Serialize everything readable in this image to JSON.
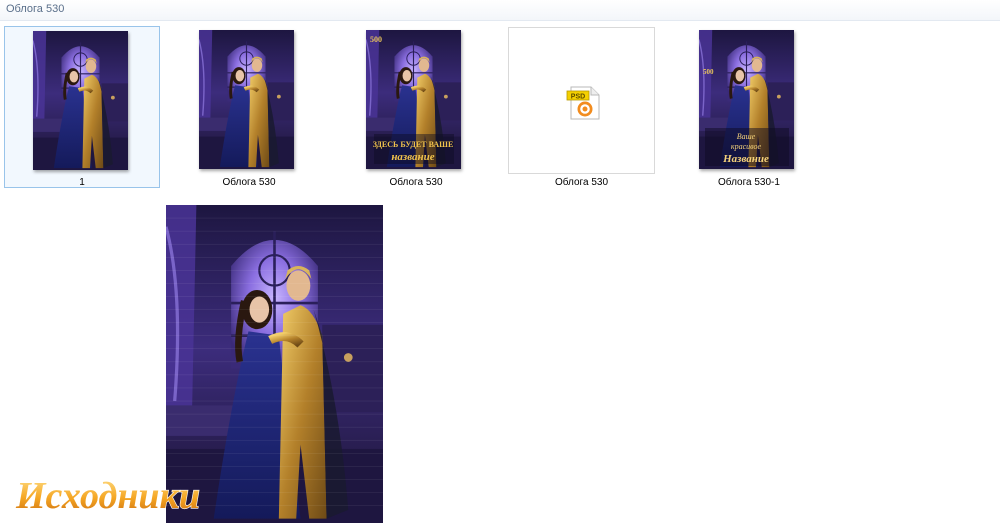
{
  "window": {
    "title": "Облога 530"
  },
  "files": [
    {
      "name": "1",
      "type": "image",
      "selected": true
    },
    {
      "name": "Облога  530",
      "type": "image",
      "selected": false
    },
    {
      "name": "Облога 530",
      "type": "image-with-title",
      "selected": false,
      "overlay_text": [
        "ЗДЕСЬ БУДЕТ ВАШЕ",
        "название"
      ],
      "badge": "500"
    },
    {
      "name": "Облога 530",
      "type": "psd",
      "selected": false,
      "badge": "PSD"
    },
    {
      "name": "Облога 530-1",
      "type": "image-with-title",
      "selected": false,
      "overlay_text": [
        "Ваше",
        "красивое",
        "Название"
      ],
      "badge": "500"
    }
  ],
  "watermark": {
    "text": "Исходники"
  },
  "colors": {
    "selection_border": "#99c4ea",
    "selection_fill": "#f2f8fe",
    "title_text": "#5a6f8a",
    "cover_purple": "#5a3fa0",
    "cover_gold": "#d4a23c",
    "watermark_orange": "#f5a623"
  },
  "icons": {
    "psd": "psd-file-icon"
  }
}
